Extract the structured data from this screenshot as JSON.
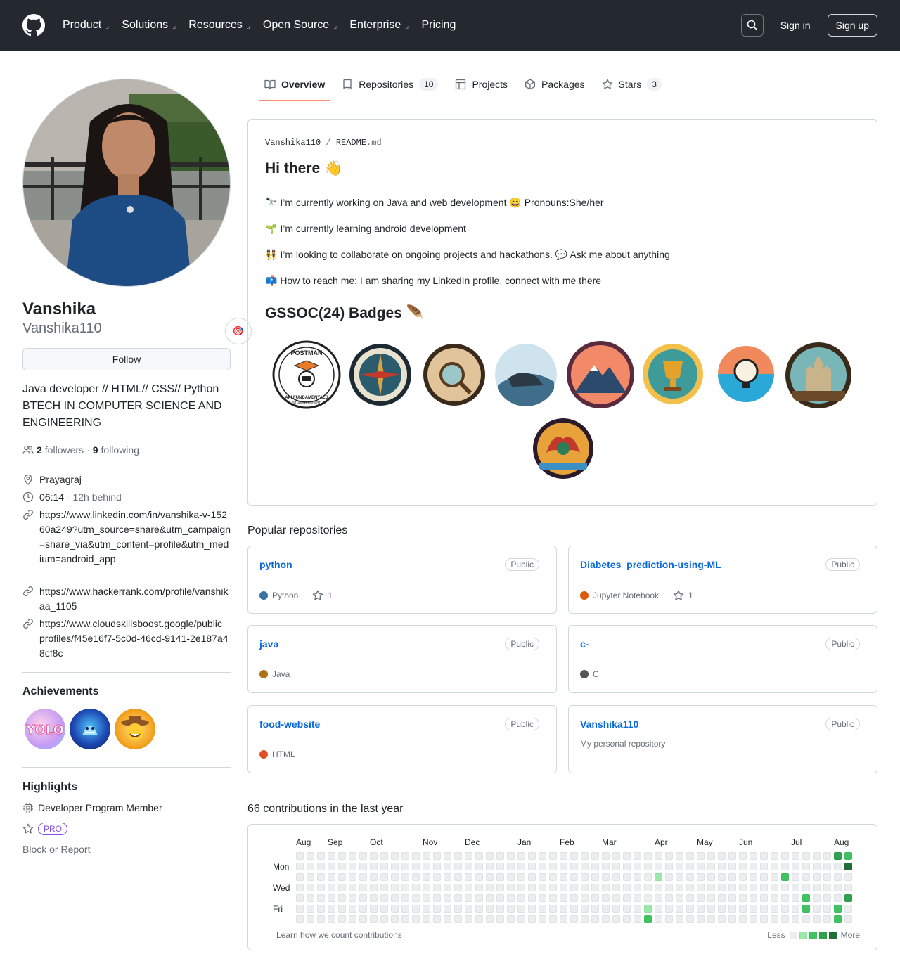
{
  "header": {
    "nav": [
      {
        "label": "Product",
        "chevron": true
      },
      {
        "label": "Solutions",
        "chevron": true
      },
      {
        "label": "Resources",
        "chevron": true
      },
      {
        "label": "Open Source",
        "chevron": true
      },
      {
        "label": "Enterprise",
        "chevron": true
      },
      {
        "label": "Pricing",
        "chevron": false
      }
    ],
    "signin": "Sign in",
    "signup": "Sign up"
  },
  "tabs": [
    {
      "label": "Overview",
      "icon": "book-icon",
      "count": null,
      "active": true
    },
    {
      "label": "Repositories",
      "icon": "repo-icon",
      "count": "10",
      "active": false
    },
    {
      "label": "Projects",
      "icon": "table-icon",
      "count": null,
      "active": false
    },
    {
      "label": "Packages",
      "icon": "package-icon",
      "count": null,
      "active": false
    },
    {
      "label": "Stars",
      "icon": "star-icon",
      "count": "3",
      "active": false
    }
  ],
  "profile": {
    "name": "Vanshika",
    "login": "Vanshika110",
    "status_emoji": "🎯",
    "follow": "Follow",
    "bio": "Java developer // HTML// CSS// Python BTECH IN COMPUTER SCIENCE AND ENGINEERING",
    "followers_count": "2",
    "followers_label": "followers",
    "separator": "·",
    "following_count": "9",
    "following_label": "following",
    "location": "Prayagraj",
    "time": "06:14",
    "time_note": "- 12h behind",
    "links": [
      "https://www.linkedin.com/in/vanshika-v-15260a249?utm_source=share&utm_campaign=share_via&utm_content=profile&utm_medium=android_app",
      "https://www.hackerrank.com/profile/vanshikaa_1105",
      "https://www.cloudskillsboost.google/public_profiles/f45e16f7-5c0d-46cd-9141-2e187a48cf8c"
    ],
    "achievements_title": "Achievements",
    "highlights_title": "Highlights",
    "highlight_dev": "Developer Program Member",
    "highlight_pro": "PRO",
    "block": "Block or Report"
  },
  "readme": {
    "owner": "Vanshika110",
    "sep": "/",
    "file": "README",
    "ext": ".md",
    "heading1": "Hi there 👋",
    "lines": [
      "🔭 I’m currently working on Java and web development 😄 Pronouns:She/her",
      "🌱 I’m currently learning android development",
      "👯 I’m looking to collaborate on ongoing projects and hackathons. 💬 Ask me about anything",
      "📫 How to reach me: I am sharing my LinkedIn profile, connect with me there"
    ],
    "heading2": "GSSOC(24) Badges 🪶",
    "postman_top": "POSTMAN",
    "postman_bottom": "API FUNDAMENTALS",
    "postman_sub": "STUDENT EXPERT"
  },
  "popular": {
    "title": "Popular repositories",
    "public": "Public",
    "repos": [
      {
        "name": "python",
        "desc": "",
        "lang": "Python",
        "color": "#3572A5",
        "stars": "1"
      },
      {
        "name": "Diabetes_prediction-using-ML",
        "desc": "",
        "lang": "Jupyter Notebook",
        "color": "#DA5B0B",
        "stars": "1"
      },
      {
        "name": "java",
        "desc": "",
        "lang": "Java",
        "color": "#b07219",
        "stars": ""
      },
      {
        "name": "c-",
        "desc": "",
        "lang": "C",
        "color": "#555555",
        "stars": ""
      },
      {
        "name": "food-website",
        "desc": "",
        "lang": "HTML",
        "color": "#e34c26",
        "stars": ""
      },
      {
        "name": "Vanshika110",
        "desc": "My personal repository",
        "lang": "",
        "color": "",
        "stars": ""
      }
    ]
  },
  "contributions": {
    "title": "66 contributions in the last year",
    "months": [
      "Aug",
      "Sep",
      "Oct",
      "Nov",
      "Dec",
      "Jan",
      "Feb",
      "Mar",
      "Apr",
      "May",
      "Jun",
      "Jul",
      "Aug"
    ],
    "days": [
      "Mon",
      "Wed",
      "Fri"
    ],
    "learn": "Learn how we count contributions",
    "less": "Less",
    "more": "More",
    "level_colors": [
      "#ebedf0",
      "#9be9a8",
      "#40c463",
      "#30a14e",
      "#216e39"
    ],
    "active_cells": [
      {
        "week": 34,
        "day": 2,
        "level": 1
      },
      {
        "week": 33,
        "day": 5,
        "level": 1
      },
      {
        "week": 33,
        "day": 6,
        "level": 2
      },
      {
        "week": 46,
        "day": 2,
        "level": 2
      },
      {
        "week": 48,
        "day": 4,
        "level": 2
      },
      {
        "week": 48,
        "day": 5,
        "level": 2
      },
      {
        "week": 51,
        "day": 0,
        "level": 3
      },
      {
        "week": 51,
        "day": 5,
        "level": 2
      },
      {
        "week": 51,
        "day": 6,
        "level": 2
      },
      {
        "week": 52,
        "day": 0,
        "level": 2
      },
      {
        "week": 52,
        "day": 1,
        "level": 4
      },
      {
        "week": 52,
        "day": 4,
        "level": 3
      }
    ]
  }
}
